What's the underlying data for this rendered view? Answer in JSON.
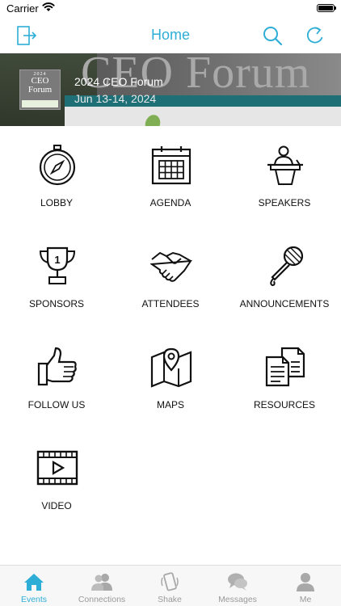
{
  "status_bar": {
    "carrier": "Carrier",
    "icons": [
      "wifi-icon",
      "battery-icon"
    ]
  },
  "nav": {
    "title": "Home",
    "left_icon": "logout-icon",
    "right_icons": [
      "search-icon",
      "refresh-icon"
    ],
    "accent": "#2eaed6"
  },
  "banner": {
    "background_text": "CEO Forum",
    "event_title": "2024 CEO Forum",
    "event_date": "Jun 13-14, 2024",
    "logo": {
      "year": "2024",
      "line1": "CEO",
      "line2": "Forum"
    }
  },
  "tiles": [
    {
      "label": "LOBBY",
      "icon": "compass-icon"
    },
    {
      "label": "AGENDA",
      "icon": "calendar-icon"
    },
    {
      "label": "SPEAKERS",
      "icon": "podium-speaker-icon"
    },
    {
      "label": "SPONSORS",
      "icon": "trophy-icon"
    },
    {
      "label": "ATTENDEES",
      "icon": "handshake-icon"
    },
    {
      "label": "ANNOUNCEMENTS",
      "icon": "microphone-icon"
    },
    {
      "label": "FOLLOW US",
      "icon": "thumbs-up-icon"
    },
    {
      "label": "MAPS",
      "icon": "map-icon"
    },
    {
      "label": "RESOURCES",
      "icon": "documents-icon"
    },
    {
      "label": "VIDEO",
      "icon": "video-icon"
    }
  ],
  "tab_bar": {
    "active": "Events",
    "tabs": [
      {
        "label": "Events",
        "icon": "home-icon"
      },
      {
        "label": "Connections",
        "icon": "people-icon"
      },
      {
        "label": "Shake",
        "icon": "shake-phone-icon"
      },
      {
        "label": "Messages",
        "icon": "chat-bubbles-icon"
      },
      {
        "label": "Me",
        "icon": "person-icon"
      }
    ],
    "active_color": "#2eaed6",
    "inactive_color": "#9a9a9a"
  }
}
